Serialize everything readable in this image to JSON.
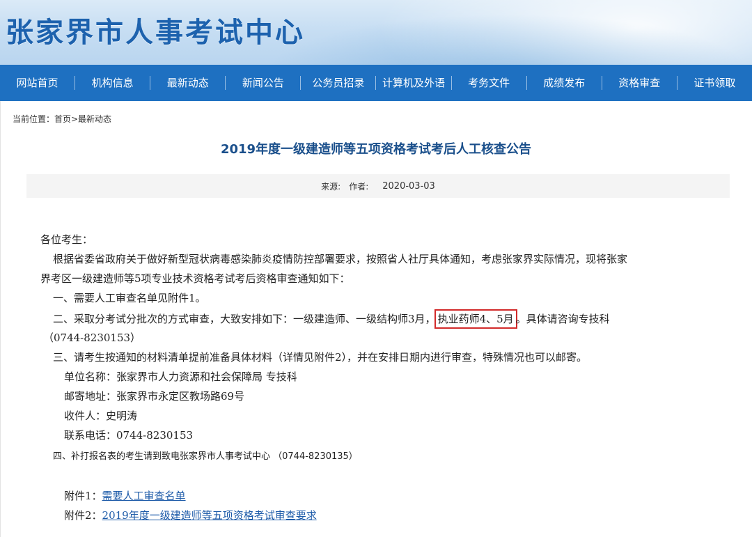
{
  "header": {
    "site_title": "张家界市人事考试中心"
  },
  "nav": {
    "items": [
      "网站首页",
      "机构信息",
      "最新动态",
      "新闻公告",
      "公务员招录",
      "计算机及外语",
      "考务文件",
      "成绩发布",
      "资格审查",
      "证书领取"
    ]
  },
  "breadcrumb": {
    "text": "当前位置：首页>最新动态"
  },
  "article": {
    "title": "2019年度一级建造师等五项资格考试考后人工核查公告",
    "source_label": "来源:",
    "author_label": "作者:",
    "date": "2020-03-03",
    "greeting": "各位考生：",
    "para1_line1": "根据省委省政府关于做好新型冠状病毒感染肺炎疫情防控部署要求，按照省人社厅具体通知，考虑张家界实际情况，现将张家",
    "para1_line2": "界考区一级建造师等5项专业技术资格考试考后资格审查通知如下：",
    "item1": "一、需要人工审查名单见附件1。",
    "item2_before": "二、采取分考试分批次的方式审查，大致安排如下：一级建造师、一级结构师3月，",
    "item2_highlight": "执业药师4、5月",
    "item2_after": "。具体请咨询专技科",
    "item2_phone": "（0744-8230153）",
    "item3": "三、请考生按通知的材料清单提前准备具体材料（详情见附件2），并在安排日期内进行审查，特殊情况也可以邮寄。",
    "unit": "单位名称：张家界市人力资源和社会保障局 专技科",
    "address": "邮寄地址：张家界市永定区教场路69号",
    "recipient": "收件人：史明涛",
    "phone": "联系电话：0744-8230153",
    "item4": "四、补打报名表的考生请到致电张家界市人事考试中心 （0744-8230135）",
    "attachment1_label": "附件1：",
    "attachment1_link": "需要人工审查名单",
    "attachment2_label": "附件2：",
    "attachment2_link": "2019年度一级建造师等五项资格考试审查要求"
  },
  "colors": {
    "nav_bg": "#1e70c1",
    "title_blue": "#1d62ae",
    "highlight_border": "#d22a2a",
    "link": "#1c5aa8"
  }
}
